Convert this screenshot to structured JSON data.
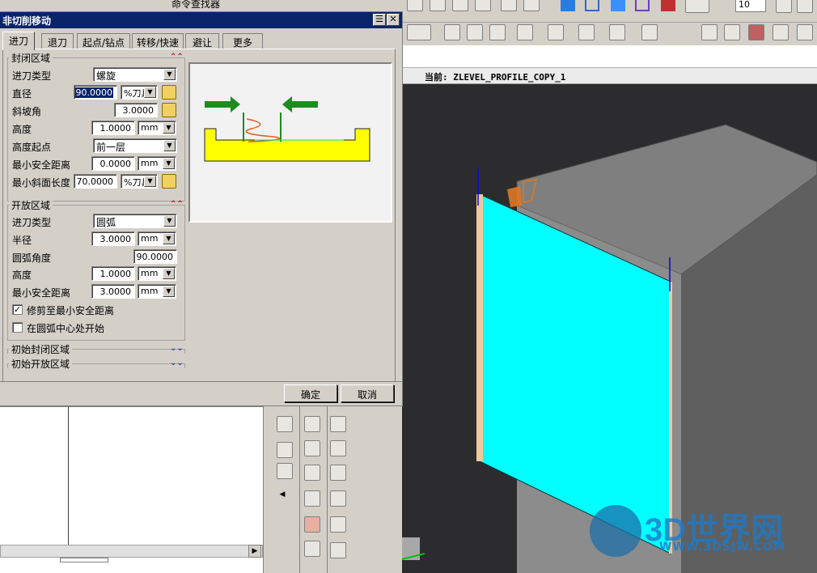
{
  "toolbar": {
    "cmd_finder_label": "命令查找器",
    "number_value": "10"
  },
  "dialog": {
    "title": "非切削移动",
    "close_glyph": "✕",
    "menu_glyph": "☰",
    "tabs": [
      "进刀",
      "退刀",
      "起点/钻点",
      "转移/快速",
      "避让",
      "更多"
    ],
    "active_tab": "进刀",
    "closed_area": {
      "title": "封闭区域",
      "fields": {
        "type_label": "进刀类型",
        "type_value": "螺旋",
        "diameter_label": "直径",
        "diameter_value": "90.0000",
        "diameter_unit": "%刀具",
        "ramp_label": "斜坡角",
        "ramp_value": "3.0000",
        "height_label": "高度",
        "height_value": "1.0000",
        "height_unit": "mm",
        "height_start_label": "高度起点",
        "height_start_value": "前一层",
        "min_clear_label": "最小安全距离",
        "min_clear_value": "0.0000",
        "min_clear_unit": "mm",
        "min_ramp_label": "最小斜面长度",
        "min_ramp_value": "70.0000",
        "min_ramp_unit": "%刀具"
      }
    },
    "open_area": {
      "title": "开放区域",
      "fields": {
        "type_label": "进刀类型",
        "type_value": "圆弧",
        "radius_label": "半径",
        "radius_value": "3.0000",
        "radius_unit": "mm",
        "arc_angle_label": "圆弧角度",
        "arc_angle_value": "90.0000",
        "height_label": "高度",
        "height_value": "1.0000",
        "height_unit": "mm",
        "min_clear_label": "最小安全距离",
        "min_clear_value": "3.0000",
        "min_clear_unit": "mm"
      },
      "trim_label": "修剪至最小安全距离",
      "trim_checked": true,
      "arc_center_label": "在圆弧中心处开始",
      "arc_center_checked": false
    },
    "initial_closed": "初始封闭区域",
    "initial_open": "初始开放区域",
    "ok_label": "确定",
    "cancel_label": "取消"
  },
  "viewport": {
    "current_label": "当前: ZLEVEL_PROFILE_COPY_1",
    "watermark_big": "3D世界网",
    "watermark_small": "WWW.3DSJW.COM"
  },
  "colors": {
    "title_bar": "#0a246a",
    "face_cyan": "#00ffff",
    "preview_yellow": "#ffff00",
    "preview_green": "#1e8c1e",
    "helix_orange": "#e06020",
    "box_gray": "#8a8a8a"
  }
}
